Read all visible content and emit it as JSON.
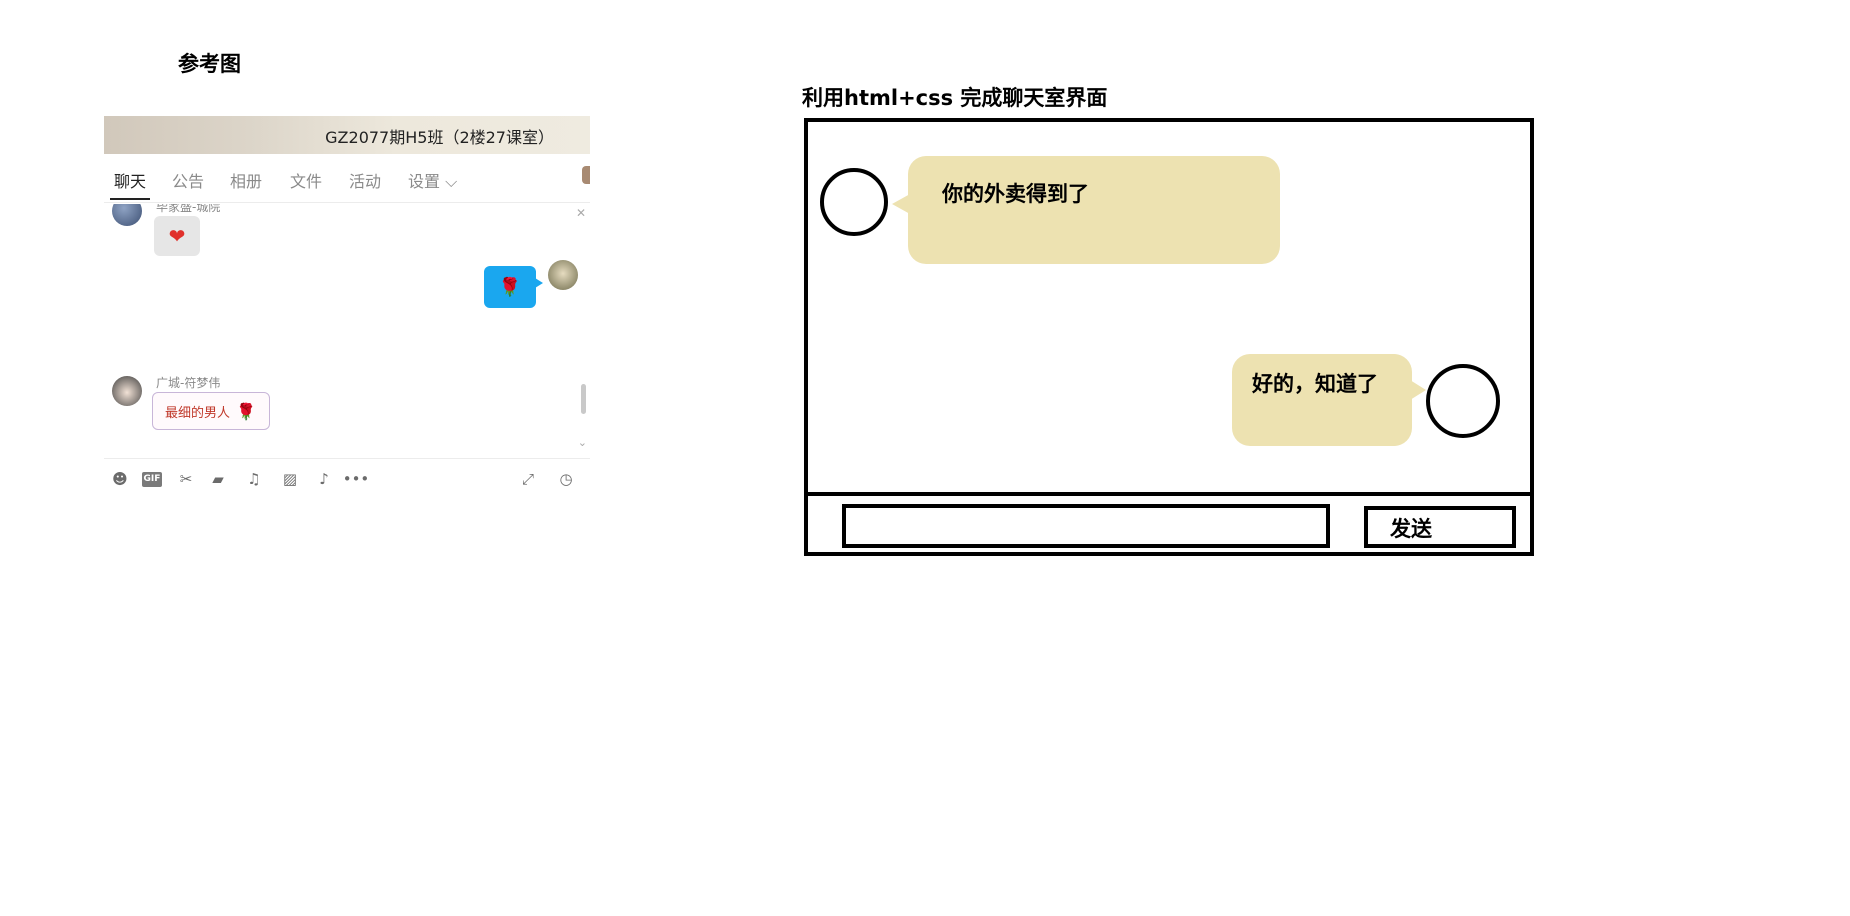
{
  "reference": {
    "title": "参考图",
    "header_title": "GZ2077期H5班（2楼27课室）",
    "tabs": [
      {
        "label": "聊天",
        "active": true
      },
      {
        "label": "公告",
        "active": false
      },
      {
        "label": "相册",
        "active": false
      },
      {
        "label": "文件",
        "active": false
      },
      {
        "label": "活动",
        "active": false
      },
      {
        "label": "设置 ⌵",
        "active": false
      }
    ],
    "messages": [
      {
        "sender": "毕家盛-城院",
        "content": "❤",
        "side": "left"
      },
      {
        "sender": "",
        "content": "🌹",
        "side": "right"
      },
      {
        "sender": "广城-符梦伟",
        "content": "最细的男人",
        "sticker": "🌹",
        "side": "left"
      }
    ],
    "toolbar_icons": [
      "emoji-icon",
      "gif-icon",
      "scissors-icon",
      "folder-icon",
      "music-icon",
      "image-icon",
      "bell-icon",
      "more-icon",
      "expand-icon",
      "history-icon"
    ],
    "gif_label": "GIF",
    "colors": {
      "self_bubble": "#1aa7ef",
      "other_bubble": "#e6e6e6"
    }
  },
  "task": {
    "title": "利用html+css 完成聊天室界面",
    "messages": [
      {
        "side": "left",
        "text": "你的外卖得到了"
      },
      {
        "side": "right",
        "text": "好的，知道了"
      }
    ],
    "input": {
      "value": "",
      "placeholder": ""
    },
    "send_label": "发送",
    "colors": {
      "bubble": "#ede2b1",
      "border": "#000000"
    }
  }
}
